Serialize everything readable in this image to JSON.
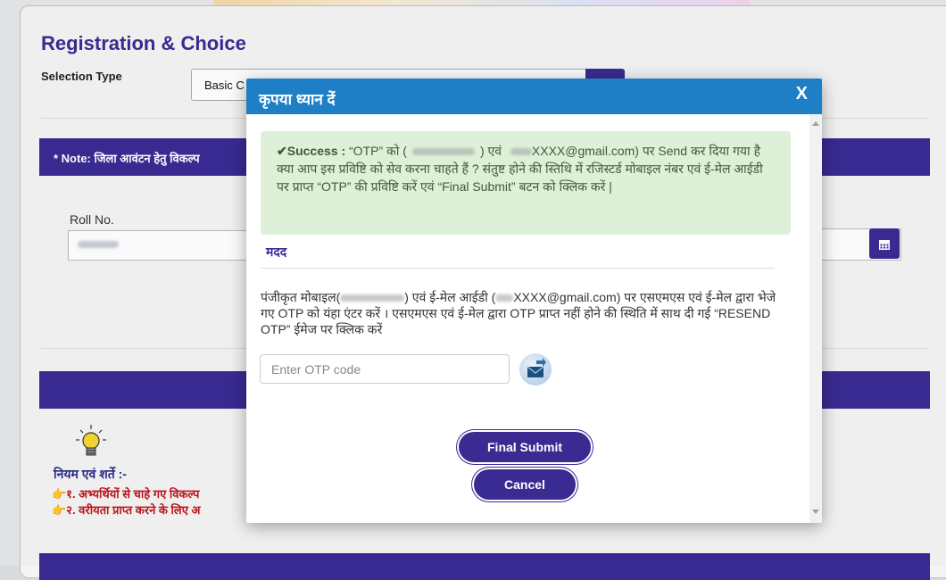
{
  "page": {
    "title": "Registration & Choice",
    "selection_type_label": "Selection Type",
    "selection_type_value": "Basic C",
    "note_text": "* Note: जिला आवंटन हेतु विकल्प",
    "roll_label": "Roll No.",
    "calendar_icon": "calendar-icon",
    "rules_title": "नियम एवं शर्ते :-",
    "rules": [
      "👉१. अभ्यर्थियों से चाहे गए विकल्प",
      "👉२. वरीयता प्राप्त करने के लिए अ"
    ]
  },
  "modal": {
    "title": "कृपया ध्यान दें",
    "close_label": "X",
    "success_label": "✔Success :",
    "success_part1": " “OTP” को (",
    "success_part2": " एवं ",
    "success_email": "XXXX@gmail.com",
    "success_part3": ") पर Send कर दिया गया है क्या आप इस प्रविष्टि को सेव करना चाहते हैं ? संतुष्ट होने की स्तिथि में रजिस्टर्ड मोबाइल नंबर एवं ई-मेल आईडी पर प्राप्त “OTP” की प्रविष्टि करें एवं “Final Submit” बटन को क्लिक करें |",
    "help_title": "मदद",
    "help_part1": "पंजीकृत मोबाइल(",
    "help_part2": ") एवं ई-मेल आईडी (",
    "help_email": "XXXX@gmail.com",
    "help_part3": ") पर एसएमएस एवं ई-मेल द्वारा भेजे गए OTP को यंहा एंटर करें । एसएमएस एवं ई-मेल द्वारा OTP प्राप्त नहीं होने की स्थिति में साथ दी गई “RESEND OTP” ईमेज पर क्लिक करें",
    "otp_placeholder": "Enter OTP code",
    "resend_icon": "resend-otp-icon",
    "final_submit_label": "Final Submit",
    "cancel_label": "Cancel"
  },
  "colors": {
    "brand": "#3a2b93",
    "modal_header": "#1f7fc6",
    "success_bg": "#dff0d8",
    "rule_text": "#c0141a"
  }
}
